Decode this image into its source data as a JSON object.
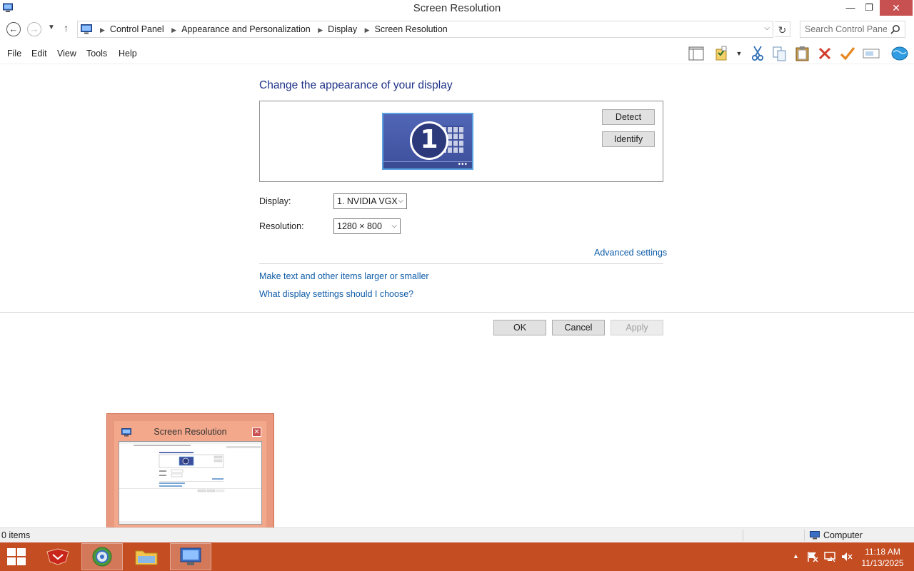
{
  "window": {
    "title": "Screen Resolution",
    "minimize": "—",
    "maximize": "❐",
    "close": "✕"
  },
  "address": {
    "crumbs": [
      "Control Panel",
      "Appearance and Personalization",
      "Display",
      "Screen Resolution"
    ],
    "search_placeholder": "Search Control Panel"
  },
  "menu": {
    "file": "File",
    "edit": "Edit",
    "view": "View",
    "tools": "Tools",
    "help": "Help"
  },
  "toolbar_icons": [
    "layout-pane-icon",
    "properties-icon",
    "cut-icon",
    "copy-icon",
    "paste-icon",
    "delete-icon",
    "checkmark-icon",
    "rename-icon",
    "globe-icon"
  ],
  "content": {
    "heading": "Change the appearance of your display",
    "monitor_number": "1",
    "detect": "Detect",
    "identify": "Identify",
    "display_label": "Display:",
    "display_value": "1. NVIDIA VGX",
    "resolution_label": "Resolution:",
    "resolution_value": "1280 × 800",
    "advanced_settings": "Advanced settings",
    "link_text_size": "Make text and other items larger or smaller",
    "link_choose": "What display settings should I choose?",
    "ok": "OK",
    "cancel": "Cancel",
    "apply": "Apply"
  },
  "thumbnail": {
    "title": "Screen Resolution",
    "close": "✕"
  },
  "status": {
    "items": "0 items",
    "location": "Computer"
  },
  "taskbar": {
    "time": "11:18 AM",
    "date": "11/13/2025"
  },
  "colors": {
    "taskbar": "#c44d22",
    "heading": "#1e3287",
    "link": "#0f5ca8",
    "close_button": "#c75050"
  }
}
